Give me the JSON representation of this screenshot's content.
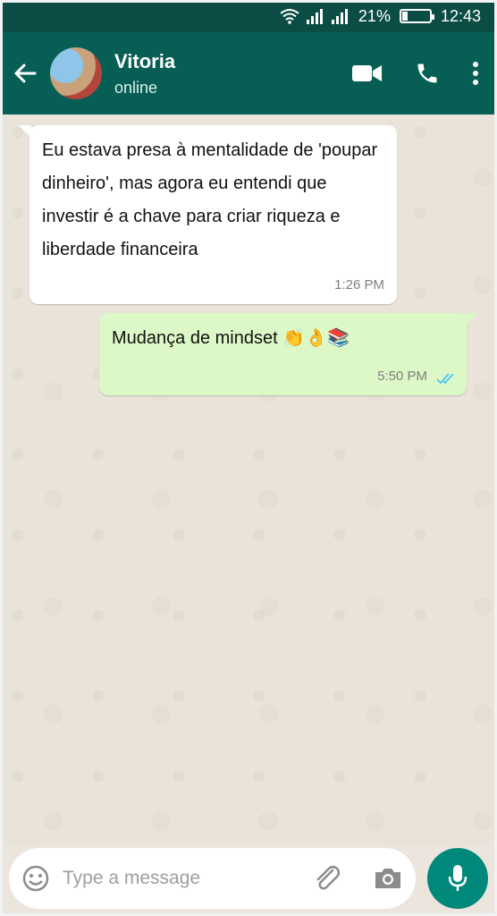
{
  "status_bar": {
    "battery": "21%",
    "time": "12:43",
    "battery_level": 0.21
  },
  "header": {
    "name": "Vitoria",
    "status": "online"
  },
  "messages": [
    {
      "direction": "incoming",
      "text": "Eu estava presa à mentalidade de 'poupar dinheiro', mas agora eu entendi que investir é a chave para criar riqueza e liberdade financeira",
      "time": "1:26 PM"
    },
    {
      "direction": "outgoing",
      "text": "Mudança de mindset 👏👌📚",
      "time": "5:50 PM"
    }
  ],
  "composer": {
    "placeholder": "Type a message"
  },
  "colors": {
    "header": "#075e54",
    "status_bar": "#0b4d44",
    "outgoing_bubble": "#dcf8c6",
    "mic_button": "#00897b",
    "read_ticks": "#4fc3f7"
  },
  "icons": [
    "wifi-icon",
    "signal-icon",
    "battery-icon",
    "back-arrow-icon",
    "video-call-icon",
    "phone-icon",
    "more-icon",
    "double-tick-icon",
    "emoji-icon",
    "attach-icon",
    "camera-icon",
    "mic-icon"
  ]
}
